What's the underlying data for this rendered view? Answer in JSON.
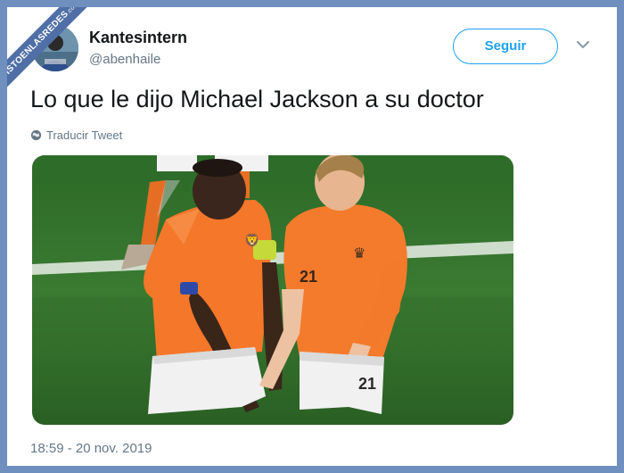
{
  "watermark": {
    "text": "VISTOENLASREDES",
    "suffix": ".com"
  },
  "user": {
    "name": "Kantesintern",
    "handle": "@abenhaile"
  },
  "follow_button": {
    "label": "Seguir"
  },
  "tweet": {
    "text": "Lo que le dijo Michael Jackson a su doctor",
    "translate_label": "Traducir Tweet",
    "timestamp": "18:59 - 20 nov. 2019"
  },
  "colors": {
    "accent": "#1da1f2",
    "jersey_orange": "#f4772a",
    "pitch_green": "#2f6a2a",
    "page_border": "#6f8fbf"
  },
  "icons": {
    "menu": "chevron-down-icon",
    "translate": "globe-icon"
  }
}
